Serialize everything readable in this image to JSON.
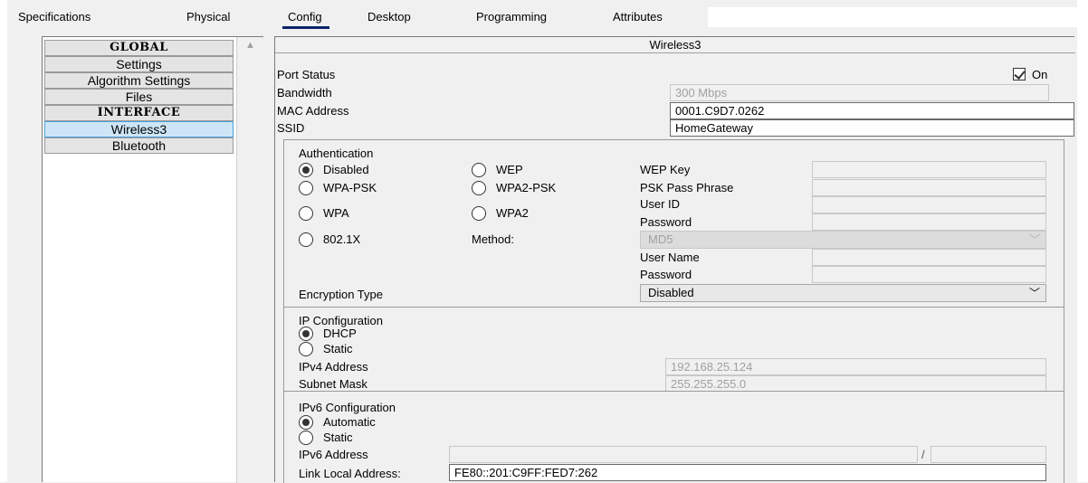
{
  "tabs": [
    {
      "label": "Specifications"
    },
    {
      "label": "Physical"
    },
    {
      "label": "Config"
    },
    {
      "label": "Desktop"
    },
    {
      "label": "Programming"
    },
    {
      "label": "Attributes"
    }
  ],
  "active_tab": "Config",
  "sidebar": {
    "items": [
      {
        "label": "GLOBAL"
      },
      {
        "label": "Settings"
      },
      {
        "label": "Algorithm Settings"
      },
      {
        "label": "Files"
      },
      {
        "label": "INTERFACE"
      },
      {
        "label": "Wireless3"
      },
      {
        "label": "Bluetooth"
      }
    ],
    "selected": "Wireless3",
    "scroll_up_icon": "▲"
  },
  "panel": {
    "title": "Wireless3",
    "port_status_label": "Port Status",
    "on_label": "On",
    "port_on": true,
    "bandwidth_label": "Bandwidth",
    "bandwidth_value": "300 Mbps",
    "mac_label": "MAC Address",
    "mac_value": "0001.C9D7.0262",
    "ssid_label": "SSID",
    "ssid_value": "HomeGateway"
  },
  "auth": {
    "title": "Authentication",
    "options": {
      "disabled": "Disabled",
      "wep": "WEP",
      "wpa_psk": "WPA-PSK",
      "wpa2_psk": "WPA2-PSK",
      "wpa": "WPA",
      "wpa2": "WPA2",
      "dot1x": "802.1X"
    },
    "selected": "Disabled",
    "wep_key_label": "WEP Key",
    "psk_label": "PSK Pass Phrase",
    "user_id_label": "User ID",
    "password_label": "Password",
    "method_label": "Method:",
    "method_value": "MD5",
    "user_name_label": "User Name",
    "password2_label": "Password",
    "encryption_label": "Encryption Type",
    "encryption_value": "Disabled"
  },
  "ip": {
    "title": "IP Configuration",
    "dhcp_label": "DHCP",
    "static_label": "Static",
    "selected": "DHCP",
    "ipv4_label": "IPv4 Address",
    "ipv4_value": "192.168.25.124",
    "mask_label": "Subnet Mask",
    "mask_value": "255.255.255.0"
  },
  "ipv6": {
    "title": "IPv6 Configuration",
    "auto_label": "Automatic",
    "static_label": "Static",
    "selected": "Automatic",
    "ipv6_label": "IPv6 Address",
    "slash": "/",
    "link_local_label": "Link Local Address:",
    "link_local_value": "FE80::201:C9FF:FED7:262"
  },
  "colors": {
    "window_bg": "#f0f0f0",
    "selected_item": "#cde6f7",
    "tab_underline": "#0a246a"
  }
}
